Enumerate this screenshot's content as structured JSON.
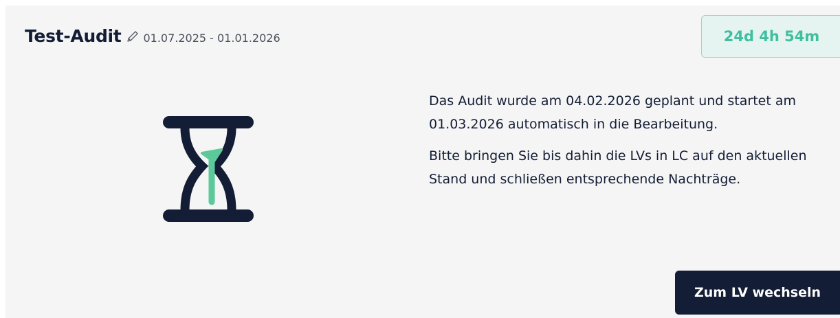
{
  "audit": {
    "title": "Test-Audit",
    "date_range": "01.07.2025 - 01.01.2026",
    "edit_icon": "pencil-icon",
    "countdown": "24d 4h 54m"
  },
  "status": {
    "icon": "hourglass-icon",
    "paragraph_1": "Das Audit wurde am 04.02.2026 geplant und startet am 01.03.2026 automatisch in die Bearbeitung.",
    "paragraph_2": "Bitte bringen Sie bis dahin die LVs in LC auf den aktuellen Stand und schließen entsprechende Nachträge."
  },
  "actions": {
    "switch_label": "Zum LV wechseln"
  },
  "colors": {
    "navy": "#131d35",
    "accent_green": "#5bc99a",
    "badge_text": "#3fbf9f",
    "badge_bg": "#e6f4f1",
    "card_bg": "#f5f5f5"
  }
}
